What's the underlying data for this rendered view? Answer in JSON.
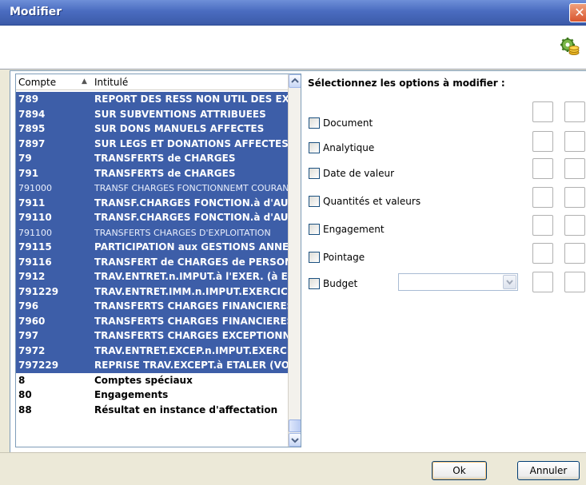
{
  "window": {
    "title": "Modifier",
    "close_glyph": "✕"
  },
  "toolbar": {
    "icon": "gear-coins-icon"
  },
  "list": {
    "header": {
      "compte": "Compte",
      "sort_icon": "sort-asc-icon",
      "intitule": "Intitulé"
    },
    "rows": [
      {
        "compte": "789",
        "intitule": "REPORT DES RESS NON UTIL DES EXERCICES ANTERIEURS",
        "selected": true,
        "light": false
      },
      {
        "compte": "7894",
        "intitule": "SUR SUBVENTIONS ATTRIBUEES",
        "selected": true,
        "light": false
      },
      {
        "compte": "7895",
        "intitule": "SUR DONS MANUELS AFFECTES",
        "selected": true,
        "light": false
      },
      {
        "compte": "7897",
        "intitule": "SUR LEGS ET DONATIONS AFFECTES",
        "selected": true,
        "light": false
      },
      {
        "compte": "79",
        "intitule": "TRANSFERTS de CHARGES",
        "selected": true,
        "light": false
      },
      {
        "compte": "791",
        "intitule": "TRANSFERTS de CHARGES",
        "selected": true,
        "light": false
      },
      {
        "compte": "791000",
        "intitule": "TRANSF CHARGES FONCTIONNEMT COURANT",
        "selected": true,
        "light": true
      },
      {
        "compte": "7911",
        "intitule": "TRANSF.CHARGES FONCTION.à d'AUTRES",
        "selected": true,
        "light": false
      },
      {
        "compte": "79110",
        "intitule": "TRANSF.CHARGES FONCTION.à d'AUTRES",
        "selected": true,
        "light": false
      },
      {
        "compte": "791100",
        "intitule": "TRANSFERTS CHARGES D'EXPLOITATION",
        "selected": true,
        "light": true
      },
      {
        "compte": "79115",
        "intitule": "PARTICIPATION aux GESTIONS ANNEXES",
        "selected": true,
        "light": false
      },
      {
        "compte": "79116",
        "intitule": "TRANSFERT de CHARGES de PERSONNEL",
        "selected": true,
        "light": false
      },
      {
        "compte": "7912",
        "intitule": "TRAV.ENTRET.n.IMPUT.à l'EXER. (à ETALER)",
        "selected": true,
        "light": false
      },
      {
        "compte": "791229",
        "intitule": "TRAV.ENTRET.IMM.n.IMPUT.EXERCICE",
        "selected": true,
        "light": false
      },
      {
        "compte": "796",
        "intitule": "TRANSFERTS CHARGES FINANCIERES",
        "selected": true,
        "light": false
      },
      {
        "compte": "7960",
        "intitule": "TRANSFERTS CHARGES FINANCIERES",
        "selected": true,
        "light": false
      },
      {
        "compte": "797",
        "intitule": "TRANSFERTS CHARGES EXCEPTIONNELLES",
        "selected": true,
        "light": false
      },
      {
        "compte": "7972",
        "intitule": "TRAV.ENTRET.EXCEP.n.IMPUT.EXERCICE",
        "selected": true,
        "light": false
      },
      {
        "compte": "797229",
        "intitule": "REPRISE TRAV.EXCEPT.à ETALER (VOIR)",
        "selected": true,
        "light": false
      },
      {
        "compte": "8",
        "intitule": "Comptes spéciaux",
        "selected": false,
        "light": false
      },
      {
        "compte": "80",
        "intitule": "Engagements",
        "selected": false,
        "light": false
      },
      {
        "compte": "88",
        "intitule": "Résultat en instance d'affectation",
        "selected": false,
        "light": false
      }
    ]
  },
  "options": {
    "title": "Sélectionnez les options à modifier :",
    "items": [
      {
        "label": "Document",
        "checked": false
      },
      {
        "label": "Analytique",
        "checked": false
      },
      {
        "label": "Date de valeur",
        "checked": false
      },
      {
        "label": "Quantités et valeurs",
        "checked": false
      },
      {
        "label": "Engagement",
        "checked": false
      },
      {
        "label": "Pointage",
        "checked": false
      },
      {
        "label": "Budget",
        "checked": false
      }
    ],
    "budget_select_value": ""
  },
  "footer": {
    "ok_label": "Ok",
    "cancel_label": "Annuler"
  }
}
